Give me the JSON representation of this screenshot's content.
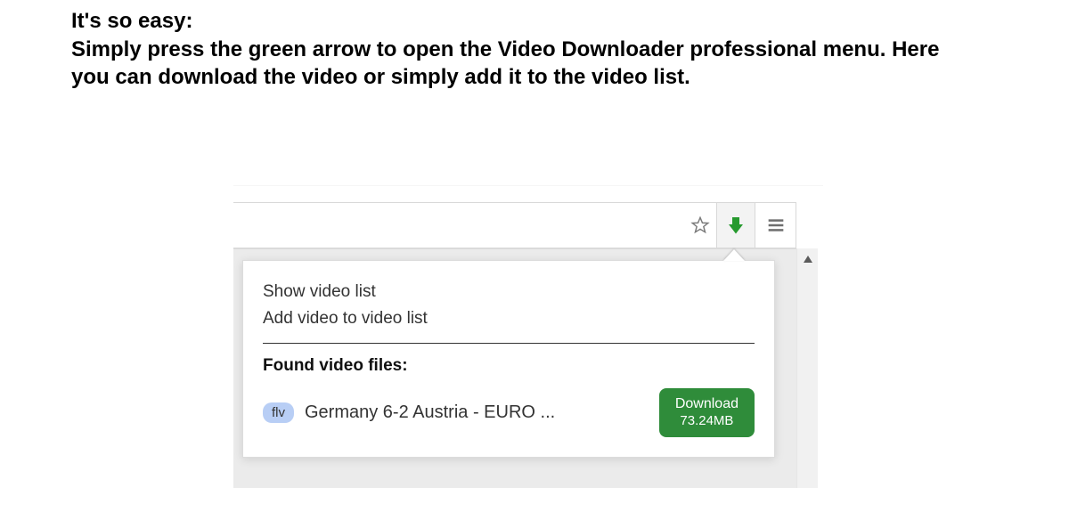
{
  "heading": {
    "line1": "It's so easy:",
    "line2": "Simply press the green arrow to open the Video Downloader professional menu. Here you can download the video or simply add it to the video list."
  },
  "toolbar": {
    "icons": {
      "star": "star-icon",
      "download_arrow": "download-arrow-icon",
      "menu": "hamburger-icon"
    },
    "colors": {
      "arrow_green": "#269a2e"
    }
  },
  "popup": {
    "menu_items": [
      "Show video list",
      "Add video to video list"
    ],
    "section_label": "Found video files:",
    "files": [
      {
        "format": "flv",
        "title": "Germany 6-2 Austria - EURO ...",
        "download_label": "Download",
        "size": "73.24MB"
      }
    ]
  }
}
